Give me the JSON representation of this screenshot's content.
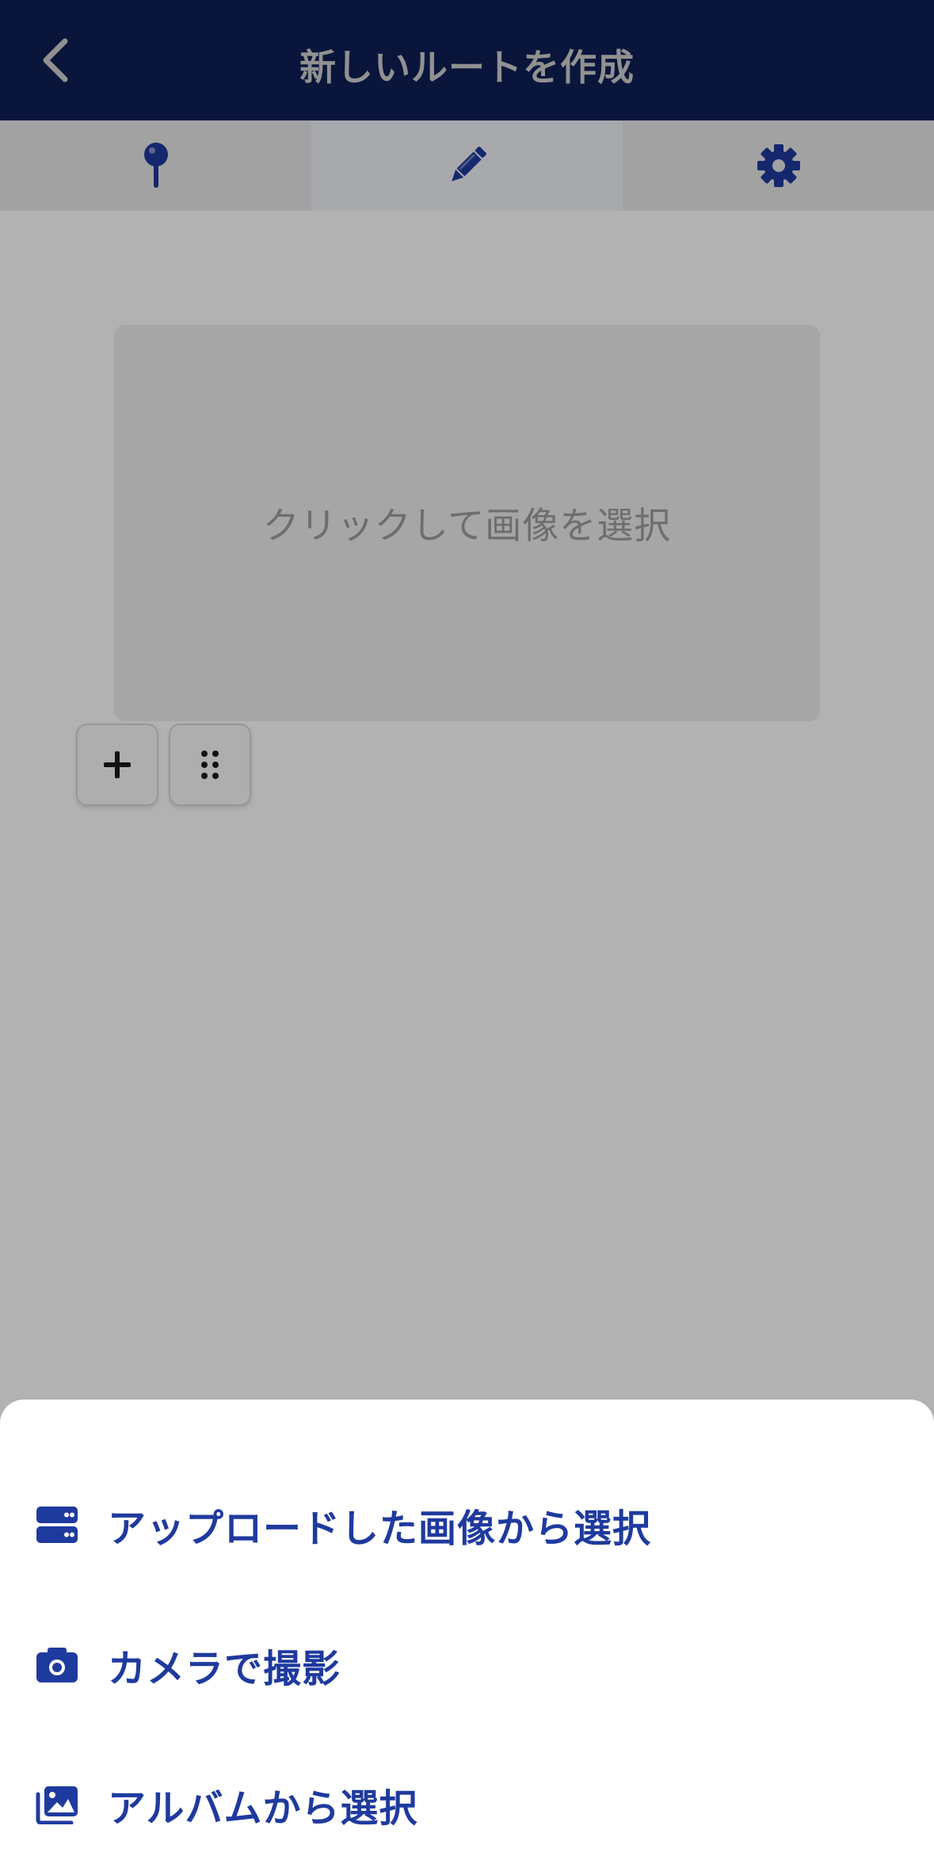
{
  "header": {
    "title": "新しいルートを作成"
  },
  "tabs": [
    {
      "icon": "map-pin-icon",
      "active": false
    },
    {
      "icon": "pencil-icon",
      "active": true
    },
    {
      "icon": "gear-icon",
      "active": false
    }
  ],
  "editor": {
    "image_placeholder": "クリックして画像を選択"
  },
  "sheet": {
    "items": [
      {
        "icon": "server-icon",
        "label": "アップロードした画像から選択"
      },
      {
        "icon": "camera-icon",
        "label": "カメラで撮影"
      },
      {
        "icon": "images-icon",
        "label": "アルバムから選択"
      }
    ]
  },
  "colors": {
    "header_bg": "#0d1f55",
    "accent": "#1f3a9e"
  }
}
